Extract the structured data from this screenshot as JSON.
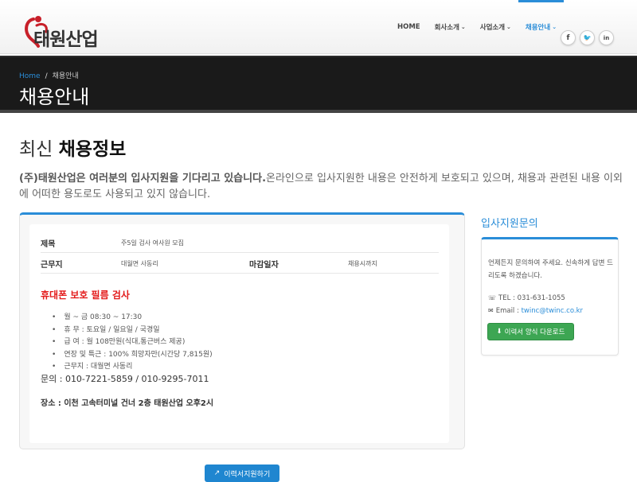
{
  "header": {
    "logo_text": "태원산업",
    "nav": [
      {
        "label": "HOME",
        "has_dropdown": false,
        "active": false
      },
      {
        "label": "회사소개",
        "has_dropdown": true,
        "active": false
      },
      {
        "label": "사업소개",
        "has_dropdown": true,
        "active": false
      },
      {
        "label": "채용안내",
        "has_dropdown": true,
        "active": true
      }
    ],
    "social": {
      "facebook": "f",
      "twitter": "🐦",
      "linkedin": "in"
    },
    "caret": "⌄",
    "accent_color": "#2a8dd8"
  },
  "titlebar": {
    "crumb_home": "Home",
    "crumb_sep": "/",
    "crumb_current": "채용안내",
    "title": "채용안내"
  },
  "content": {
    "heading_light": "최신 ",
    "heading_bold": "채용정보",
    "intro_bold": "(주)태원산업은 여러분의 입사지원을 기다리고 있습니다.",
    "intro_rest": "온라인으로 입사지원한 내용은 안전하게 보호되고 있으며, 채용과 관련된 내용 이외에 어떠한 용도로도 사용되고 있지 않습니다."
  },
  "job": {
    "title_label": "제목",
    "title_value": "주5일 검사 여사원 모집",
    "location_label": "근무지",
    "location_value": "대월면 사동리",
    "deadline_label": "마감일자",
    "deadline_value": "채용시까지",
    "alert": "휴대폰 보호 필름 검사",
    "details": [
      "월 ~ 금 08:30 ~ 17:30",
      "휴 무 : 토요일 / 일요일 / 국경일",
      "급 여 : 월 108만원(식대,통근버스 제공)",
      "연장 및 특근 : 100% 희망자만(시간당 7,815원)",
      "근무지 : 대월면 사동리"
    ],
    "contact": "문의 : 010-7221-5859 / 010-9295-7011",
    "place": "장소 : 이천 고속터미널 건너 2층 태원산업 오후2시"
  },
  "sidebar": {
    "title": "입사지원문의",
    "text": "언제든지 문의하여 주세요. 신속하게 답변 드리도록 하겠습니다.",
    "tel_label": "TEL : ",
    "tel": "031-631-1055",
    "email_label": "Email : ",
    "email": "twinc@twinc.co.kr",
    "download_button": "이력서 양식 다운로드",
    "download_color": "#3da653"
  },
  "apply_button": "이력서지원하기"
}
